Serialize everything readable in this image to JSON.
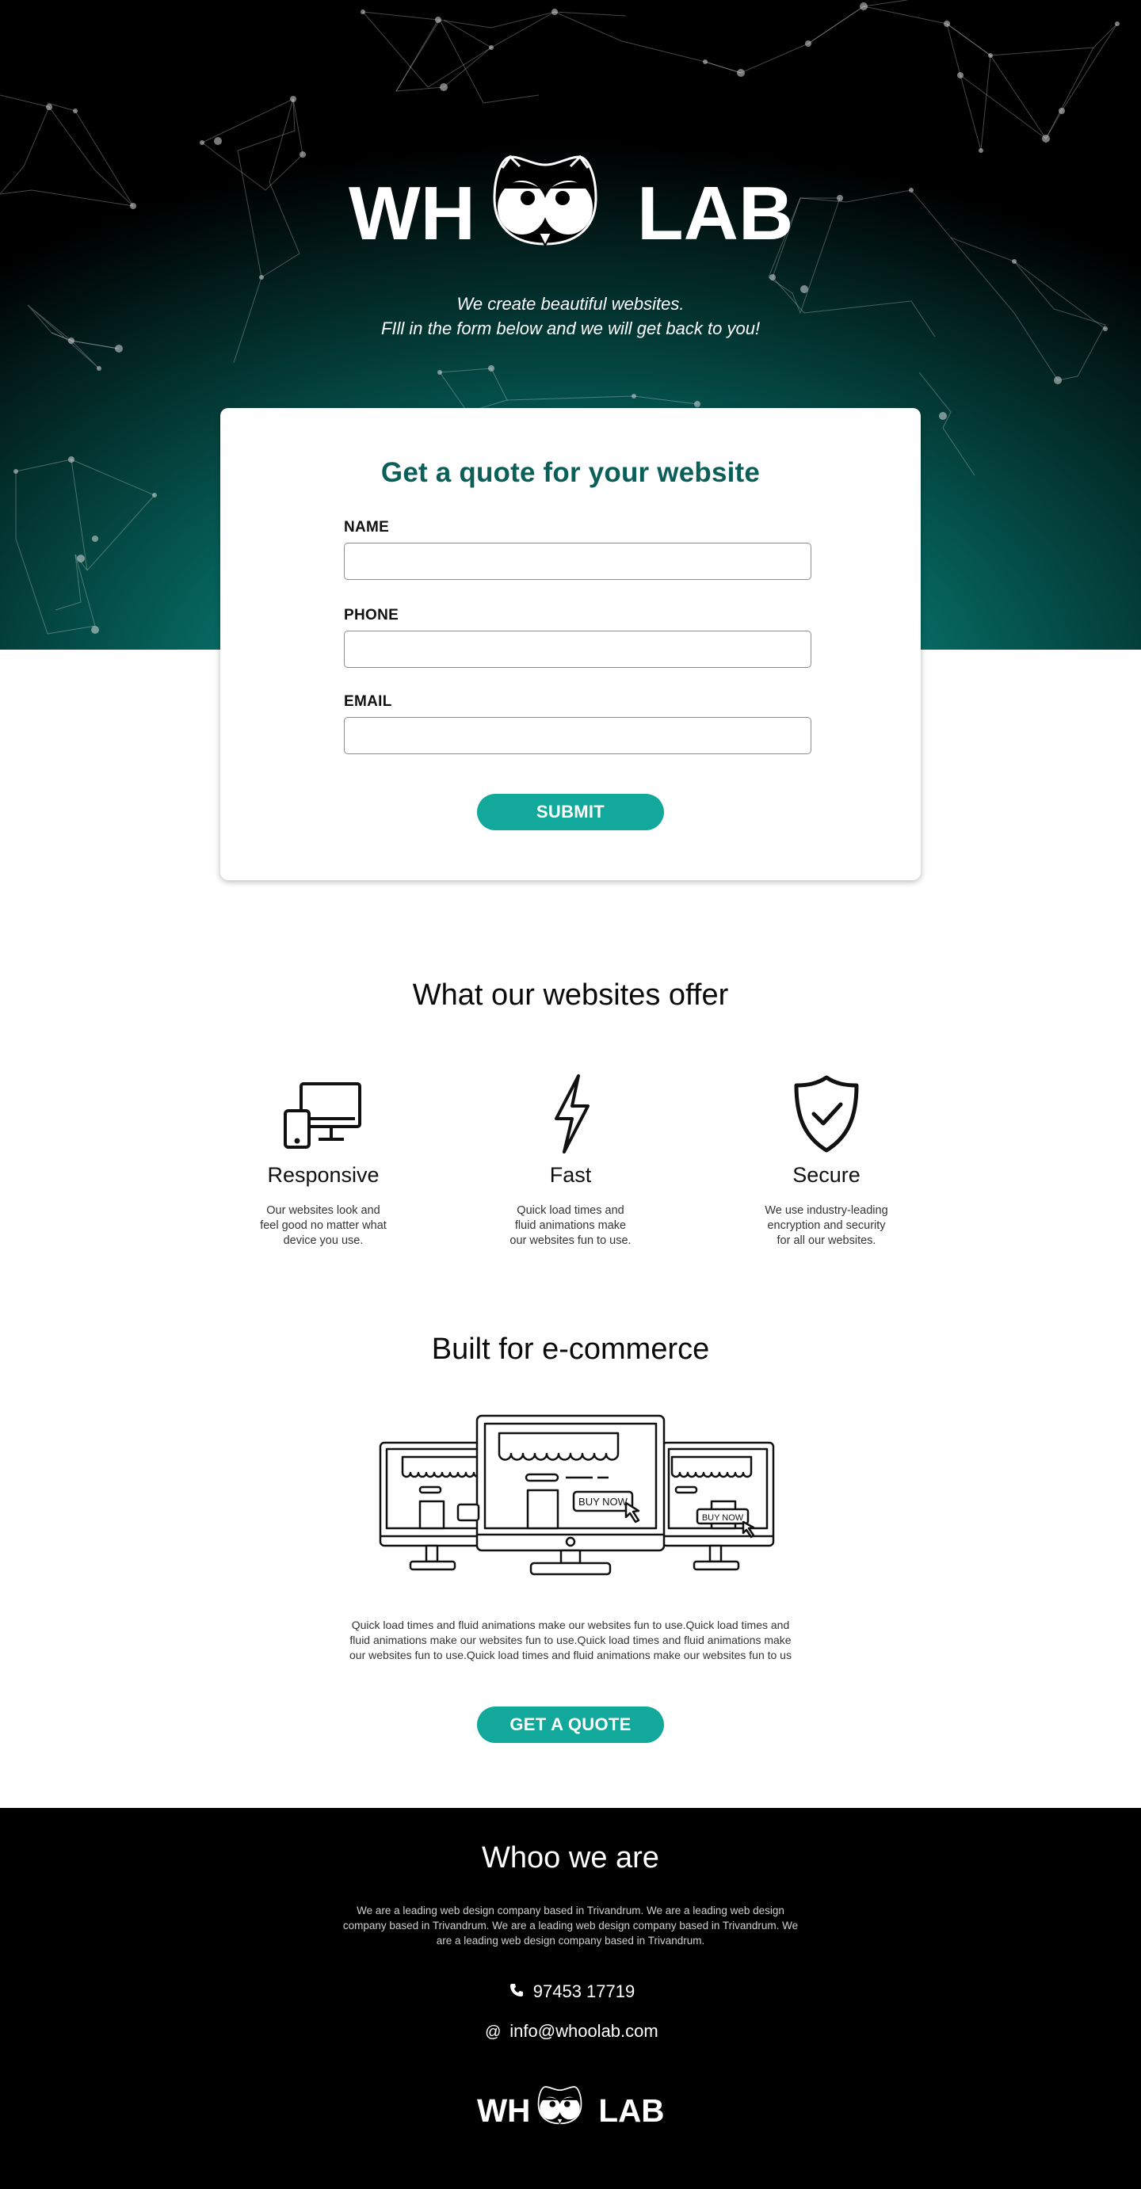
{
  "brand": {
    "name_left": "WH",
    "name_right": "LAB",
    "accent_color": "#12a89b",
    "title_color": "#0b5f59"
  },
  "hero": {
    "tagline_line1": "We create beautiful websites.",
    "tagline_line2": "FIll in the form below and we will get back to you!"
  },
  "form": {
    "title": "Get a quote for your website",
    "fields": [
      {
        "label": "NAME",
        "value": "",
        "placeholder": ""
      },
      {
        "label": "PHONE",
        "value": "",
        "placeholder": ""
      },
      {
        "label": "EMAIL",
        "value": "",
        "placeholder": ""
      }
    ],
    "submit_label": "SUBMIT"
  },
  "offer": {
    "title": "What our websites offer",
    "features": [
      {
        "icon": "devices-icon",
        "title": "Responsive",
        "desc": "Our websites look and feel good no matter what device you use."
      },
      {
        "icon": "lightning-icon",
        "title": "Fast",
        "desc": "Quick load times and fluid animations make our websites fun to use."
      },
      {
        "icon": "shield-check-icon",
        "title": "Secure",
        "desc": "We use industry-leading encryption and security for all our websites."
      }
    ]
  },
  "ecommerce": {
    "title": "Built for e-commerce",
    "illustration_label": "BUY NOW",
    "description": "Quick load times and fluid animations make our websites fun to use.Quick load times and fluid animations make our websites fun to use.Quick load times and fluid animations make our websites fun to use.Quick load times and fluid animations make our websites fun to us",
    "cta_label": "GET A QUOTE"
  },
  "footer": {
    "title": "Whoo we are",
    "about": "We are a leading web design company based in Trivandrum. We are a leading web design company based in Trivandrum. We are a leading web design company based in Trivandrum. We are a leading web design company based in Trivandrum.",
    "phone": "97453 17719",
    "email": "info@whoolab.com"
  }
}
